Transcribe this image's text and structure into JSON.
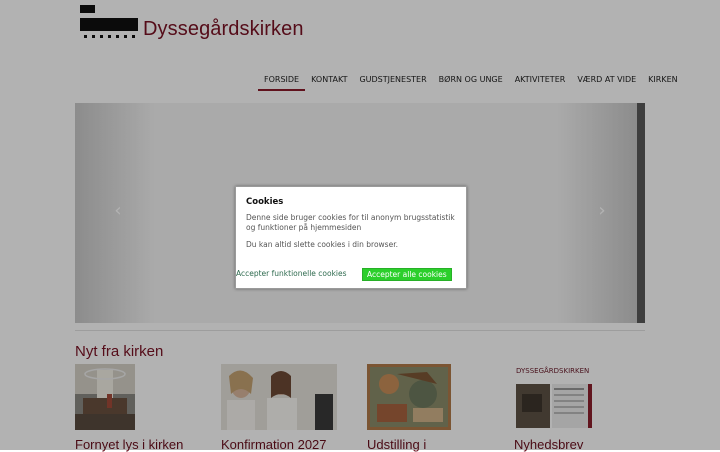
{
  "header": {
    "site_title": "Dyssegårdskirken"
  },
  "nav": {
    "items": [
      {
        "label": "Forside",
        "active": true
      },
      {
        "label": "Kontakt"
      },
      {
        "label": "Gudstjenester"
      },
      {
        "label": "Børn og unge"
      },
      {
        "label": "Aktiviteter"
      },
      {
        "label": "Værd at vide"
      },
      {
        "label": "Kirken"
      }
    ]
  },
  "carousel": {
    "prev_icon": "chevron-left-icon",
    "next_icon": "chevron-right-icon"
  },
  "news": {
    "title": "Nyt fra kirken",
    "cards": [
      {
        "title": "Fornyet lys i kirken"
      },
      {
        "title": "Konfirmation 2027"
      },
      {
        "title": "Udstilling i"
      },
      {
        "title": "Nyhedsbrev"
      }
    ]
  },
  "cookie_modal": {
    "title": "Cookies",
    "text": "Denne side bruger cookies for til anonym brugsstatistik og funktioner på hjemmesiden",
    "text2": "Du kan altid slette cookies i din browser.",
    "button_functional": "Accepter funktionelle cookies",
    "button_all": "Accepter alle cookies"
  },
  "colors": {
    "brand": "#7a1224",
    "accept_green": "#2bcf2b"
  }
}
